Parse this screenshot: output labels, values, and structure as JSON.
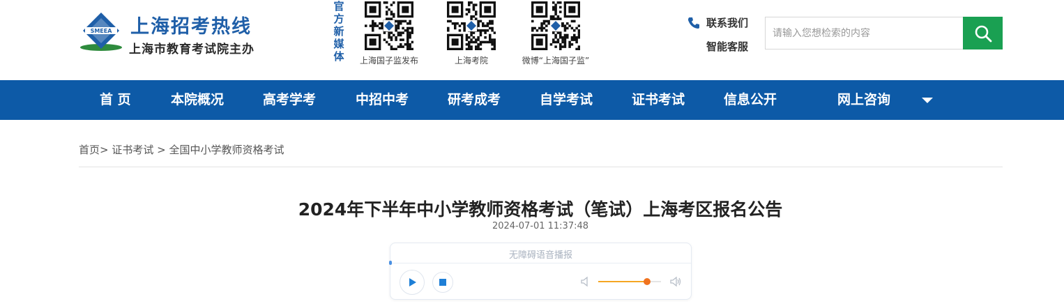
{
  "header": {
    "logo_badge": "SMEEA",
    "logo_title": "上海招考热线",
    "logo_subtitle": "上海市教育考试院主办",
    "media_label": "官方新媒体",
    "qr_codes": [
      {
        "caption": "上海国子监发布"
      },
      {
        "caption": "上海考院"
      },
      {
        "caption": "微博“上海国子监”"
      }
    ],
    "contact_label": "联系我们",
    "service_label": "智能客服",
    "search_placeholder": "请输入您想检索的内容"
  },
  "nav": {
    "items": [
      "首 页",
      "本院概况",
      "高考学考",
      "中招中考",
      "研考成考",
      "自学考试",
      "证书考试",
      "信息公开",
      "网上咨询"
    ]
  },
  "breadcrumb": {
    "home": "首页",
    "sep1": ">",
    "level1": "证书考试",
    "sep2": ">",
    "level2": "全国中小学教师资格考试"
  },
  "article": {
    "title": "2024年下半年中小学教师资格考试（笔试）上海考区报名公告",
    "time": "2024-07-01 11:37:48"
  },
  "player": {
    "label": "无障碍语音播报",
    "volume": 0.78
  },
  "colors": {
    "brand_blue": "#0d5aa7",
    "search_green": "#1aa052",
    "volume_orange": "#f0731f"
  }
}
